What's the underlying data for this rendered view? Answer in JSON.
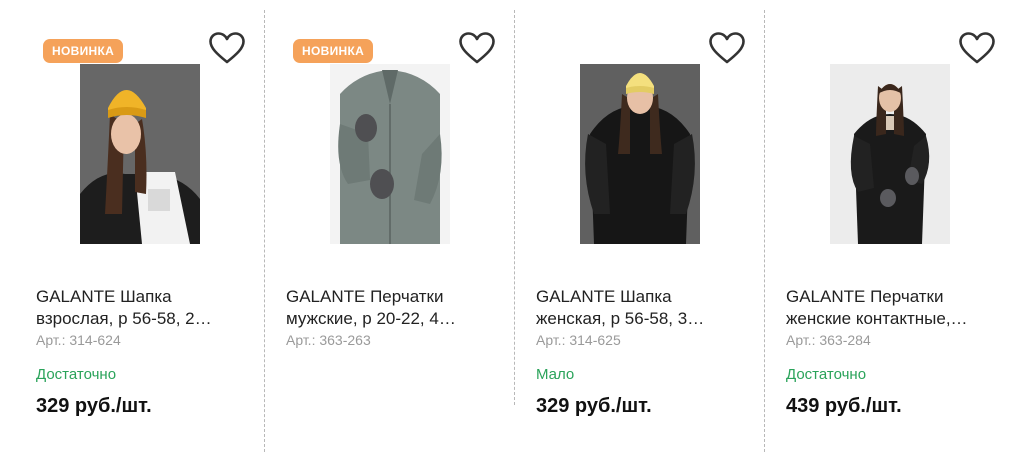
{
  "products": [
    {
      "badge": "НОВИНКА",
      "title": "GALANTE Шапка взрослая, р 56-58, 2…",
      "sku": "Арт.: 314-624",
      "stock": "Достаточно",
      "price": "329 руб./шт.",
      "image_icon": "model-yellow-beanie-white-hoodie",
      "favorite_icon": "heart-outline-icon"
    },
    {
      "badge": "НОВИНКА",
      "title": "GALANTE Перчатки мужские, р 20-22, 4…",
      "sku": "Арт.: 363-263",
      "stock": "",
      "price": "",
      "image_icon": "model-gray-jacket-gloves",
      "favorite_icon": "heart-outline-icon"
    },
    {
      "badge": "",
      "title": "GALANTE Шапка женская, р 56-58, 3…",
      "sku": "Арт.: 314-625",
      "stock": "Мало",
      "price": "329 руб./шт.",
      "image_icon": "model-pale-yellow-beanie-black-coat",
      "favorite_icon": "heart-outline-icon"
    },
    {
      "badge": "",
      "title": "GALANTE Перчатки женские контактные,…",
      "sku": "Арт.: 363-284",
      "stock": "Достаточно",
      "price": "439 руб./шт.",
      "image_icon": "model-black-coat-gray-gloves",
      "favorite_icon": "heart-outline-icon"
    }
  ],
  "colors": {
    "badge_bg": "#f5a25a",
    "stock_green": "#2aa35a",
    "sku_gray": "#9a9a9a",
    "price": "#111111"
  }
}
